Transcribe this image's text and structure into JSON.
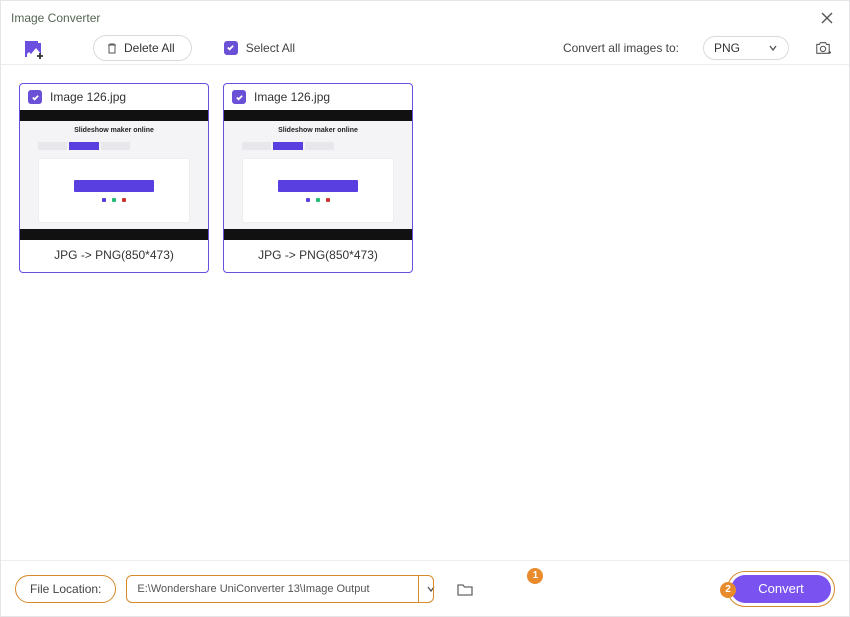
{
  "window": {
    "title": "Image Converter"
  },
  "toolbar": {
    "delete_all": "Delete All",
    "select_all": "Select All",
    "convert_label": "Convert all images to:",
    "format": "PNG"
  },
  "thumb_inner_title": "Slideshow maker online",
  "items": [
    {
      "name": "Image 126.jpg",
      "conversion": "JPG -> PNG(850*473)"
    },
    {
      "name": "Image 126.jpg",
      "conversion": "JPG -> PNG(850*473)"
    }
  ],
  "footer": {
    "file_location_label": "File Location:",
    "path": "E:\\Wondershare UniConverter 13\\Image Output",
    "convert_label": "Convert"
  },
  "annotations": {
    "one": "1",
    "two": "2"
  },
  "colors": {
    "accent": "#6b4de0",
    "annotation": "#d68a2a"
  }
}
